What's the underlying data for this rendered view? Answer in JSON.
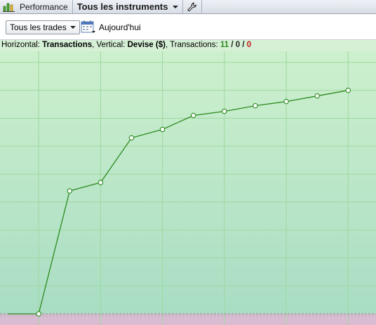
{
  "tabs": [
    {
      "label": "Performance",
      "icon": "bar-chart-icon",
      "bold": false
    },
    {
      "label": "Tous les instruments",
      "bold": true,
      "has_dropdown": true
    },
    {
      "icon": "wrench-icon"
    }
  ],
  "toolbar": {
    "filter_value": "Tous les trades",
    "calendar_icon": "calendar-icon",
    "date_label": "Aujourd'hui"
  },
  "infobar": {
    "horizontal_prefix": "Horizontal: ",
    "horizontal_value": "Transactions",
    "vertical_prefix": ", Vertical: ",
    "vertical_value": "Devise ($)",
    "transactions_prefix": ", Transactions: ",
    "count_total": "11",
    "sep1": " / ",
    "count_mid": "0",
    "sep2": " / ",
    "count_last": "0"
  },
  "colors": {
    "line": "#2c8a1f",
    "bg_top": "#cdf0cd",
    "bg_bottom": "#a9ddc4",
    "negative_zone": "#d9bcd2",
    "grid": "#9fd89f",
    "count_green": "#2c8a1f",
    "count_red": "#c41a1a"
  },
  "chart_data": {
    "type": "line",
    "xlabel": "Transactions",
    "ylabel": "Devise ($)",
    "x": [
      0,
      1,
      2,
      3,
      4,
      5,
      6,
      7,
      8,
      9,
      10,
      11
    ],
    "series": [
      {
        "values": [
          0,
          0,
          44,
          47,
          63,
          66,
          71,
          72.5,
          74.5,
          76,
          78,
          80
        ]
      }
    ],
    "xlim": [
      -0.25,
      11.9
    ],
    "ylim": [
      -4,
      94
    ],
    "grid": true
  }
}
